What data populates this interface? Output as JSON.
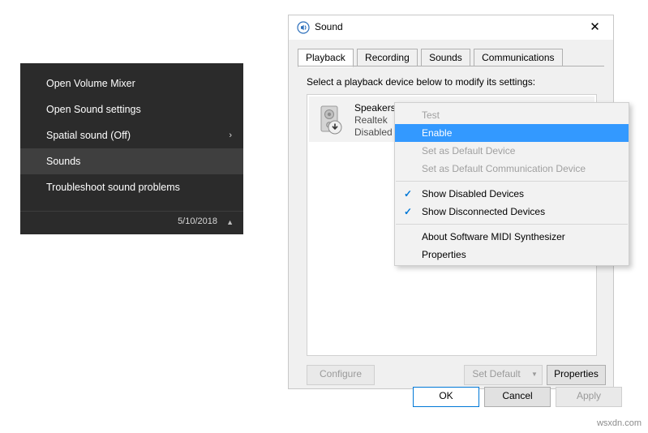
{
  "tray_menu": {
    "items": [
      {
        "label": "Open Volume Mixer",
        "selected": false,
        "submenu": false
      },
      {
        "label": "Open Sound settings",
        "selected": false,
        "submenu": false
      },
      {
        "label": "Spatial sound (Off)",
        "selected": false,
        "submenu": true
      },
      {
        "label": "Sounds",
        "selected": true,
        "submenu": false
      },
      {
        "label": "Troubleshoot sound problems",
        "selected": false,
        "submenu": false
      }
    ],
    "chevron": "›",
    "clock_date": "5/10/2018",
    "clock_caret": "▲"
  },
  "dialog": {
    "title": "Sound",
    "icon": "speaker-icon",
    "close_label": "✕",
    "tabs": [
      {
        "label": "Playback",
        "active": true
      },
      {
        "label": "Recording",
        "active": false
      },
      {
        "label": "Sounds",
        "active": false
      },
      {
        "label": "Communications",
        "active": false
      }
    ],
    "prompt": "Select a playback device below to modify its settings:",
    "devices": [
      {
        "name": "Speakers",
        "line2": "Realtek",
        "line3": "Disabled"
      }
    ],
    "buttons": {
      "configure": "Configure",
      "set_default": "Set Default",
      "set_default_arrow": "▼",
      "properties": "Properties",
      "ok": "OK",
      "cancel": "Cancel",
      "apply": "Apply"
    }
  },
  "context_menu": {
    "items": [
      {
        "label": "Test",
        "state": "disabled",
        "check": ""
      },
      {
        "label": "Enable",
        "state": "highlight",
        "check": ""
      },
      {
        "label": "Set as Default Device",
        "state": "disabled",
        "check": ""
      },
      {
        "label": "Set as Default Communication Device",
        "state": "disabled",
        "check": ""
      },
      {
        "label": "__SEPARATOR__",
        "state": "separator",
        "check": ""
      },
      {
        "label": "Show Disabled Devices",
        "state": "normal",
        "check": "✓"
      },
      {
        "label": "Show Disconnected Devices",
        "state": "normal",
        "check": "✓"
      },
      {
        "label": "__SEPARATOR__",
        "state": "separator",
        "check": ""
      },
      {
        "label": "About Software MIDI Synthesizer",
        "state": "normal",
        "check": ""
      },
      {
        "label": "Properties",
        "state": "normal",
        "check": ""
      }
    ]
  },
  "watermark": "wsxdn.com"
}
